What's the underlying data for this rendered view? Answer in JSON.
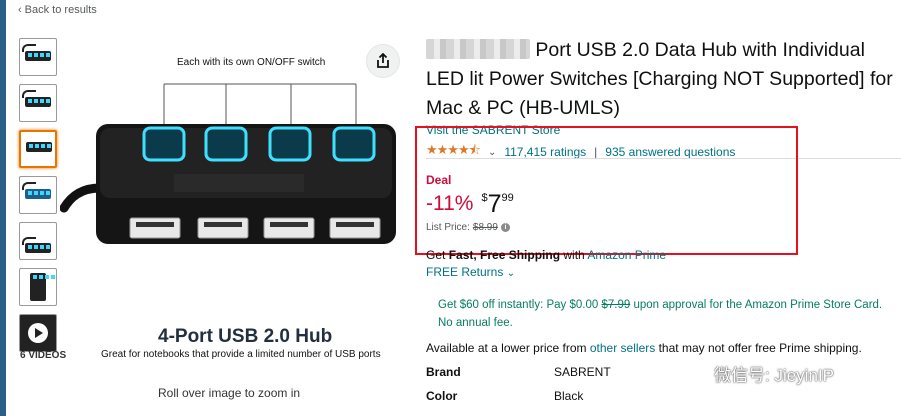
{
  "nav": {
    "back_label": "Back to results"
  },
  "gallery": {
    "thumbnail_count": 7,
    "active_index": 2,
    "video_label": "6 VIDEOS",
    "image_caption_top": "Each with its own ON/OFF switch",
    "image_title": "4-Port USB 2.0 Hub",
    "image_subtitle": "Great for notebooks that provide a limited number of USB ports",
    "zoom_hint": "Roll over image to zoom in",
    "share_icon": "share-icon"
  },
  "product": {
    "title_visible": "Port USB 2.0 Data Hub with Individual LED lit Power Switches [Charging NOT Supported] for Mac & PC (HB-UMLS)",
    "store_link": "Visit the SABRENT Store",
    "rating_stars": 4.5,
    "ratings_count": "117,415 ratings",
    "answered_questions": "935 answered questions"
  },
  "pricing": {
    "deal_label": "Deal",
    "discount": "-11%",
    "currency": "$",
    "whole": "7",
    "fraction": "99",
    "list_price_label": "List Price:",
    "list_price": "$8.99"
  },
  "shipping": {
    "get": "Get",
    "fast_free": "Fast, Free Shipping",
    "with": "with",
    "prime": "Amazon Prime",
    "free_returns": "FREE Returns"
  },
  "promo": {
    "text1": "Get $60 off instantly: Pay $0.00",
    "struck": "$7.99",
    "text2": "upon approval for the Amazon Prime Store Card. No annual fee."
  },
  "lower_price": {
    "text1": "Available at a lower price from",
    "link": "other sellers",
    "text2": "that may not offer free Prime shipping."
  },
  "specs": [
    {
      "key": "Brand",
      "value": "SABRENT"
    },
    {
      "key": "Color",
      "value": "Black"
    }
  ],
  "watermark": {
    "text": "微信号: JieyinIP"
  },
  "colors": {
    "deal_red": "#CC0C39",
    "link_teal": "#007185",
    "promo_green": "#067D62",
    "star_orange": "#de7921",
    "highlight_box": "#e6101e"
  }
}
